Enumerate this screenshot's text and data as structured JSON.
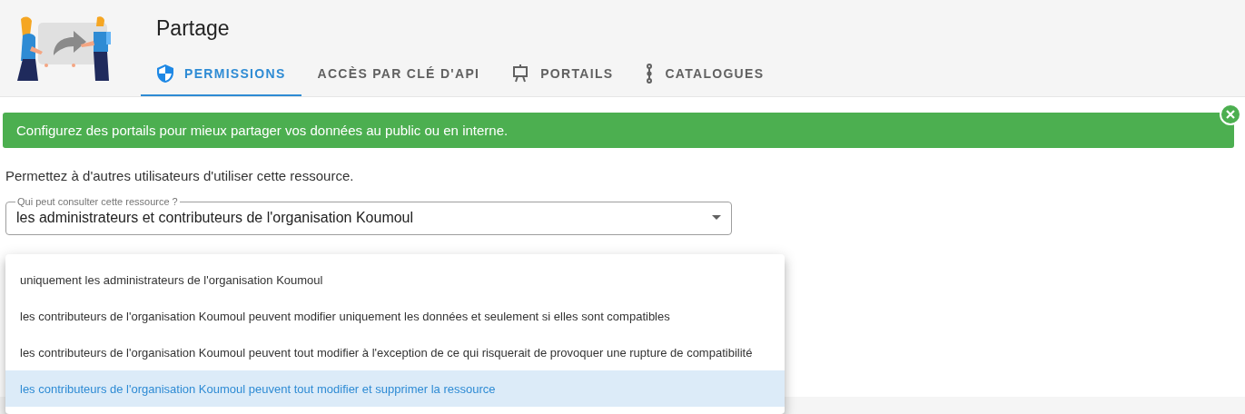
{
  "header": {
    "title": "Partage"
  },
  "tabs": [
    {
      "label": "PERMISSIONS",
      "kind": "shield",
      "selected": true
    },
    {
      "label": "ACCÈS PAR CLÉ D'API",
      "kind": "none",
      "selected": false
    },
    {
      "label": "PORTAILS",
      "kind": "easel",
      "selected": false
    },
    {
      "label": "CATALOGUES",
      "kind": "chain",
      "selected": false
    }
  ],
  "alert": {
    "text": "Configurez des portails pour mieux partager vos données au public ou en interne."
  },
  "intro": "Permettez à d'autres utilisateurs d'utiliser cette ressource.",
  "fields": [
    {
      "label": "Qui peut consulter cette ressource ?",
      "value": "les administrateurs et contributeurs de l'organisation Koumoul",
      "focused": false
    }
  ],
  "menu": {
    "options": [
      {
        "label": "uniquement les administrateurs de l'organisation Koumoul",
        "selected": false
      },
      {
        "label": "les contributeurs de l'organisation Koumoul peuvent modifier uniquement les données et seulement si elles sont compatibles",
        "selected": false
      },
      {
        "label": "les contributeurs de l'organisation Koumoul peuvent tout modifier à l'exception de ce qui risquerait de provoquer une rupture de compatibilité",
        "selected": false
      },
      {
        "label": "les contributeurs de l'organisation Koumoul peuvent tout modifier et supprimer la ressource",
        "selected": true
      }
    ]
  }
}
